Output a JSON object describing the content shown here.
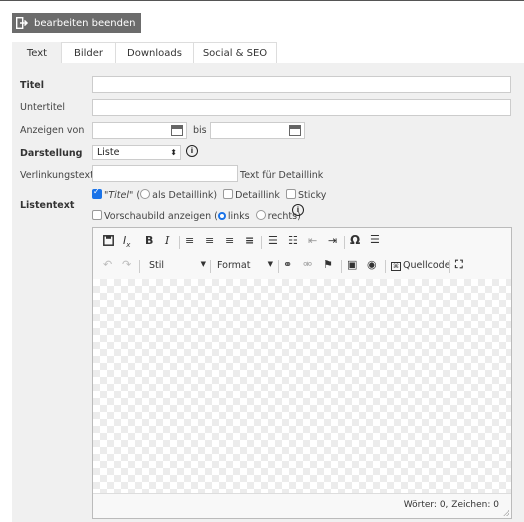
{
  "exit_button": {
    "label": "bearbeiten beenden"
  },
  "tabs": [
    {
      "label": "Text",
      "active": true
    },
    {
      "label": "Bilder",
      "active": false
    },
    {
      "label": "Downloads",
      "active": false
    },
    {
      "label": "Social & SEO",
      "active": false
    }
  ],
  "form": {
    "titel": {
      "label": "Titel",
      "value": ""
    },
    "untertitel": {
      "label": "Untertitel",
      "value": ""
    },
    "anzeigen": {
      "label": "Anzeigen von",
      "bis": "bis",
      "from_value": "",
      "to_value": ""
    },
    "darstellung": {
      "label": "Darstellung",
      "selected": "Liste"
    },
    "verlinkung": {
      "label": "Verlinkungstext",
      "value": "",
      "hint": "Text für Detaillink"
    },
    "listentext": {
      "label": "Listentext",
      "opt_titel": "\"Titel\"",
      "open_paren": " (",
      "opt_als_detaillink": "als Detaillink)",
      "opt_detaillink": "Detaillink",
      "opt_sticky": "Sticky",
      "opt_vorschaubild": "Vorschaubild anzeigen (",
      "opt_links": "links",
      "opt_rechts": "rechts)",
      "titel_checked": true
    }
  },
  "editor": {
    "stil_label": "Stil",
    "format_label": "Format",
    "source_label": "Quellcode",
    "word_count": "Wörter: 0, Zeichen: 0"
  },
  "colors": {
    "accent": "#1a73e8",
    "exit_bg": "#6c6c6c",
    "panel_bg": "#f0f0f0"
  }
}
